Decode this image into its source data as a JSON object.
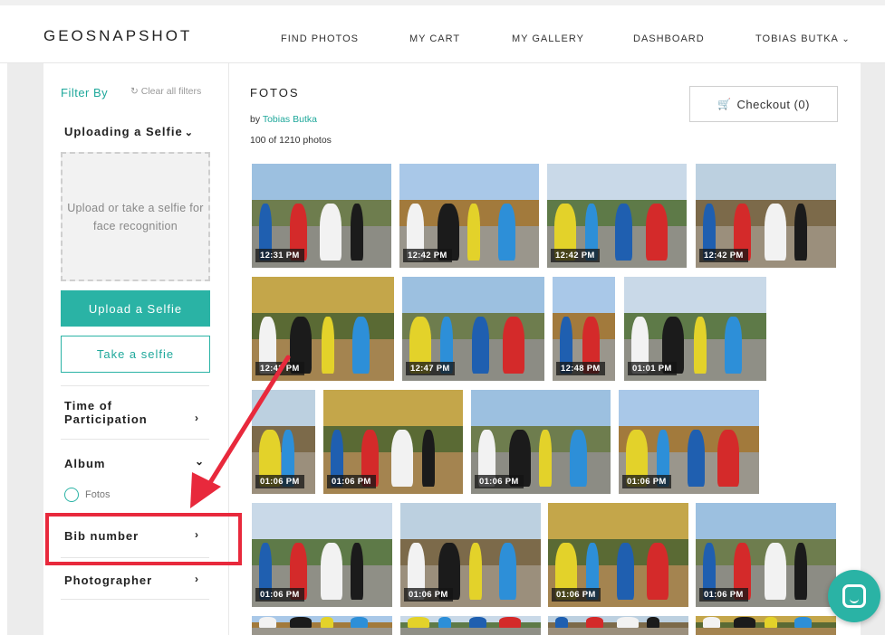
{
  "header": {
    "logo": "GEOSNAPSHOT",
    "nav": [
      "FIND PHOTOS",
      "MY CART",
      "MY GALLERY",
      "DASHBOARD",
      "TOBIAS BUTKA"
    ],
    "user_chevron": "⌄"
  },
  "sidebar": {
    "filter_by": "Filter By",
    "clear_all": "Clear all filters",
    "selfie_section": "Uploading a Selfie",
    "dropzone_text": "Upload or take a selfie for face recognition",
    "upload_button": "Upload a Selfie",
    "take_button": "Take a selfie",
    "time_section": "Time of Participation",
    "album_section": "Album",
    "album_option": "Fotos",
    "bib_section": "Bib number",
    "photographer_section": "Photographer"
  },
  "main": {
    "title": "FOTOS",
    "by_prefix": "by",
    "photographer": "Tobias Butka",
    "count": "100 of 1210 photos",
    "checkout": "Checkout (0)"
  },
  "photos": [
    "12:31 PM",
    "12:42 PM",
    "12:42 PM",
    "12:42 PM",
    "12:43 PM",
    "12:47 PM",
    "12:48 PM",
    "01:01 PM",
    "01:06 PM",
    "01:06 PM",
    "01:06 PM",
    "01:06 PM",
    "01:06 PM",
    "01:06 PM",
    "01:06 PM",
    "01:06 PM"
  ],
  "colors": {
    "accent": "#2ab3a5",
    "highlight": "#e8293c"
  }
}
